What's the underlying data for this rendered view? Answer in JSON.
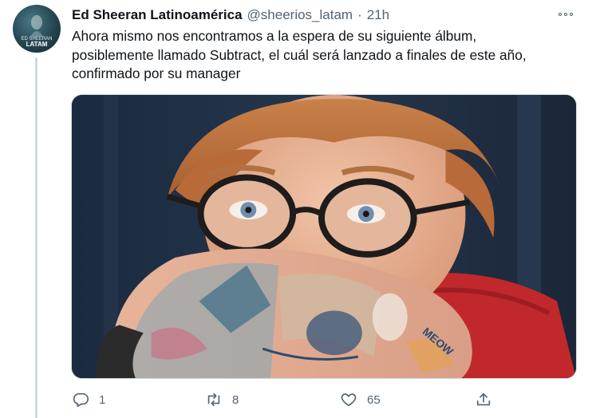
{
  "tweet": {
    "display_name": "Ed Sheeran Latinoamérica",
    "handle": "@sheerios_latam",
    "separator": "·",
    "time": "21h",
    "avatar_text": "ED SHEERAN LATAM",
    "text_lines": [
      "Ahora mismo nos encontramos a la espera de su siguiente álbum,",
      "posiblemente llamado Subtract, el cuál será lanzado a finales de este año,",
      "confirmado por su manager"
    ],
    "media_tattoo_text": "MEOW",
    "replies": "1",
    "retweets": "8",
    "likes": "65"
  },
  "icons": {
    "more": "more-horizontal-icon",
    "reply": "reply-bubble-icon",
    "retweet": "retweet-icon",
    "like": "heart-icon",
    "share": "share-upload-icon"
  },
  "colors": {
    "text_primary": "#0f1419",
    "text_secondary": "#536471",
    "thread_line": "#cfd9de"
  }
}
